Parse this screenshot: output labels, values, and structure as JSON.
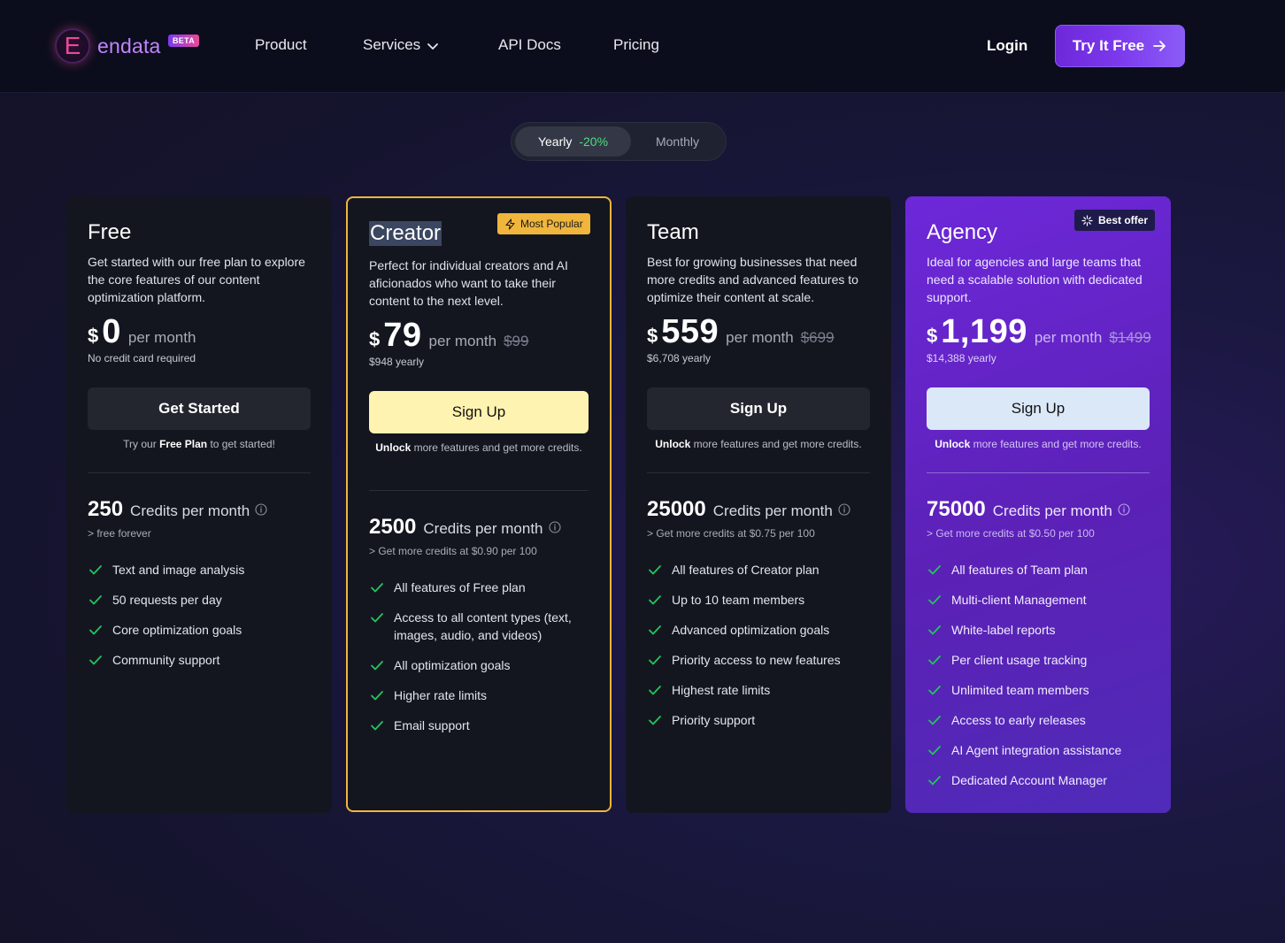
{
  "nav": {
    "logo_letter": "E",
    "logo_text": "endata",
    "beta_label": "BETA",
    "links": [
      "Product",
      "Services",
      "API Docs",
      "Pricing"
    ],
    "login_label": "Login",
    "cta_label": "Try It Free"
  },
  "billing_toggle": {
    "yearly_label": "Yearly",
    "yearly_discount": "-20%",
    "monthly_label": "Monthly",
    "selected": "Yearly"
  },
  "plans": [
    {
      "name": "Free",
      "description": "Get started with our free plan to explore the core features of our content optimization platform.",
      "currency": "$",
      "price": "0",
      "period": "per month",
      "old_price": "",
      "price_sub": "No credit card required",
      "cta_label": "Get Started",
      "note_prefix": "Try our ",
      "note_bold": "Free Plan",
      "note_suffix": " to get started!",
      "credits": "250",
      "credits_label": "Credits per month",
      "credits_sub": "> free forever",
      "features": [
        "Text and image analysis",
        "50 requests per day",
        "Core optimization goals",
        "Community support"
      ]
    },
    {
      "name": "Creator",
      "badge": "Most Popular",
      "description": "Perfect for individual creators and AI aficionados who want to take their content to the next level.",
      "currency": "$",
      "price": "79",
      "period": "per month",
      "old_price": "$99",
      "price_sub": "$948 yearly",
      "cta_label": "Sign Up",
      "note_prefix": "",
      "note_bold": "Unlock",
      "note_suffix": " more features and get more credits.",
      "credits": "2500",
      "credits_label": "Credits per month",
      "credits_sub": "> Get more credits at $0.90 per 100",
      "features": [
        "All features of Free plan",
        "Access to all content types (text, images, audio, and videos)",
        "All optimization goals",
        "Higher rate limits",
        "Email support"
      ]
    },
    {
      "name": "Team",
      "description": "Best for growing businesses that need more credits and advanced features to optimize their content at scale.",
      "currency": "$",
      "price": "559",
      "period": "per month",
      "old_price": "$699",
      "price_sub": "$6,708 yearly",
      "cta_label": "Sign Up",
      "note_prefix": "",
      "note_bold": "Unlock",
      "note_suffix": " more features and get more credits.",
      "credits": "25000",
      "credits_label": "Credits per month",
      "credits_sub": "> Get more credits at $0.75 per 100",
      "features": [
        "All features of Creator plan",
        "Up to 10 team members",
        "Advanced optimization goals",
        "Priority access to new features",
        "Highest rate limits",
        "Priority support"
      ]
    },
    {
      "name": "Agency",
      "badge": "Best offer",
      "description": "Ideal for agencies and large teams that need a scalable solution with dedicated support.",
      "currency": "$",
      "price": "1,199",
      "period": "per month",
      "old_price": "$1499",
      "price_sub": "$14,388 yearly",
      "cta_label": "Sign Up",
      "note_prefix": "",
      "note_bold": "Unlock",
      "note_suffix": " more features and get more credits.",
      "credits": "75000",
      "credits_label": "Credits per month",
      "credits_sub": "> Get more credits at $0.50 per 100",
      "features": [
        "All features of Team plan",
        "Multi-client Management",
        "White-label reports",
        "Per client usage tracking",
        "Unlimited team members",
        "Access to early releases",
        "AI Agent integration assistance",
        "Dedicated Account Manager"
      ]
    }
  ],
  "colors": {
    "accent_purple": "#7c3aed",
    "popular_border": "#f0b53c",
    "check_green": "#22c55e",
    "discount_green": "#4ade80"
  },
  "icons": {
    "check": "check-icon",
    "info": "info-icon",
    "chevron": "chevron-down-icon",
    "arrow": "arrow-right-icon",
    "bolt": "bolt-icon",
    "sparkle": "sparkle-icon"
  }
}
